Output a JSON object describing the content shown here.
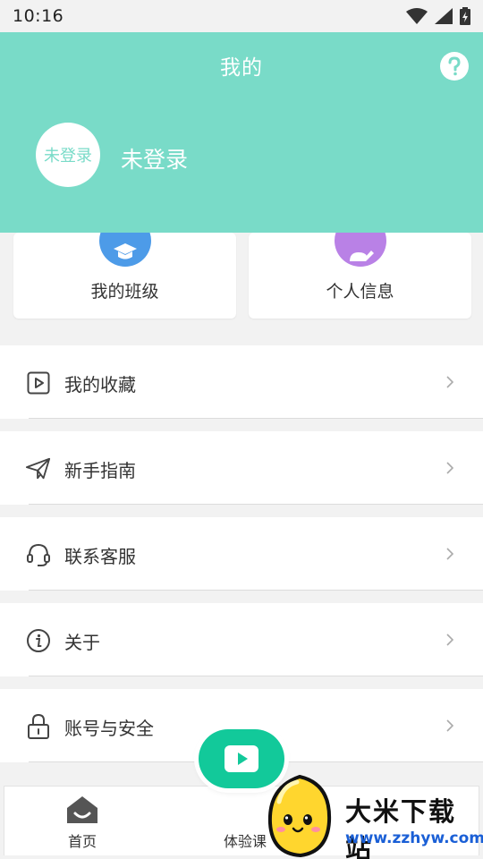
{
  "status_bar": {
    "time": "10:16",
    "icons": [
      "wifi-icon",
      "signal-icon",
      "battery-icon"
    ]
  },
  "header": {
    "title": "我的",
    "help_icon": "question-icon",
    "avatar_text": "未登录",
    "username": "未登录",
    "background_color": "#79dbc8"
  },
  "cards": [
    {
      "label": "我的班级",
      "icon": "graduation-cap-icon",
      "color": "#4d9be8"
    },
    {
      "label": "个人信息",
      "icon": "user-edit-icon",
      "color": "#b981e6"
    }
  ],
  "menu": [
    {
      "label": "我的收藏",
      "icon": "video-favorite-icon"
    },
    {
      "label": "新手指南",
      "icon": "paper-plane-icon"
    },
    {
      "label": "联系客服",
      "icon": "headset-icon"
    },
    {
      "label": "关于",
      "icon": "info-icon"
    },
    {
      "label": "账号与安全",
      "icon": "lock-icon"
    }
  ],
  "bottom_nav": [
    {
      "label": "首页",
      "icon": "home-icon"
    },
    {
      "label": "体验课",
      "icon": "play-icon"
    }
  ],
  "fab": {
    "icon": "play-icon",
    "color": "#12c99a"
  },
  "watermark": {
    "title": "大米下载站",
    "url": "www.zzhyw.com"
  }
}
